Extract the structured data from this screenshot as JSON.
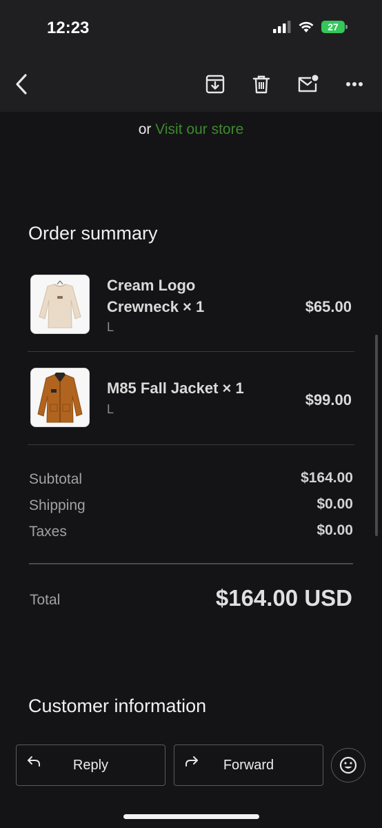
{
  "status": {
    "time": "12:23",
    "battery": "27"
  },
  "header": {
    "icons": [
      "back-arrow-icon",
      "archive-icon",
      "trash-icon",
      "mark-unread-icon",
      "more-icon"
    ]
  },
  "store": {
    "prefix": "or",
    "link": "Visit our store",
    "link_color": "#3d8a2c"
  },
  "order_summary": {
    "title": "Order summary",
    "items": [
      {
        "name_line1": "Cream Logo",
        "name_line2": "Crewneck × 1",
        "variant": "L",
        "price": "$65.00"
      },
      {
        "name_line1": "M85 Fall Jacket × 1",
        "variant": "L",
        "price": "$99.00"
      }
    ],
    "subtotal_label": "Subtotal",
    "subtotal": "$164.00",
    "shipping_label": "Shipping",
    "shipping": "$0.00",
    "taxes_label": "Taxes",
    "taxes": "$0.00",
    "total_label": "Total",
    "total": "$164.00 USD"
  },
  "customer": {
    "title": "Customer information"
  },
  "actions": {
    "reply": "Reply",
    "forward": "Forward"
  }
}
